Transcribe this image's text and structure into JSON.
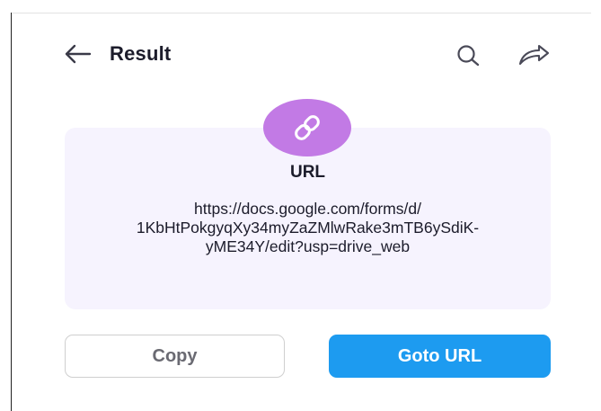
{
  "header": {
    "title": "Result",
    "back_icon": "arrow-left-icon",
    "search_icon": "search-icon",
    "share_icon": "share-icon"
  },
  "result": {
    "type_label": "URL",
    "badge_icon": "link-icon",
    "url_lines": [
      "https://docs.google.com/forms/d/",
      "1KbHtPokgyqXy34myZaZMlwRake3mTB6ySdiK-",
      "yME34Y/edit?usp=drive_web"
    ]
  },
  "actions": {
    "copy_label": "Copy",
    "goto_label": "Goto URL"
  },
  "colors": {
    "accent": "#1d9bf0",
    "badge": "#c27ae5",
    "card_background": "#f6f3fe",
    "text": "#1c1c2b"
  }
}
